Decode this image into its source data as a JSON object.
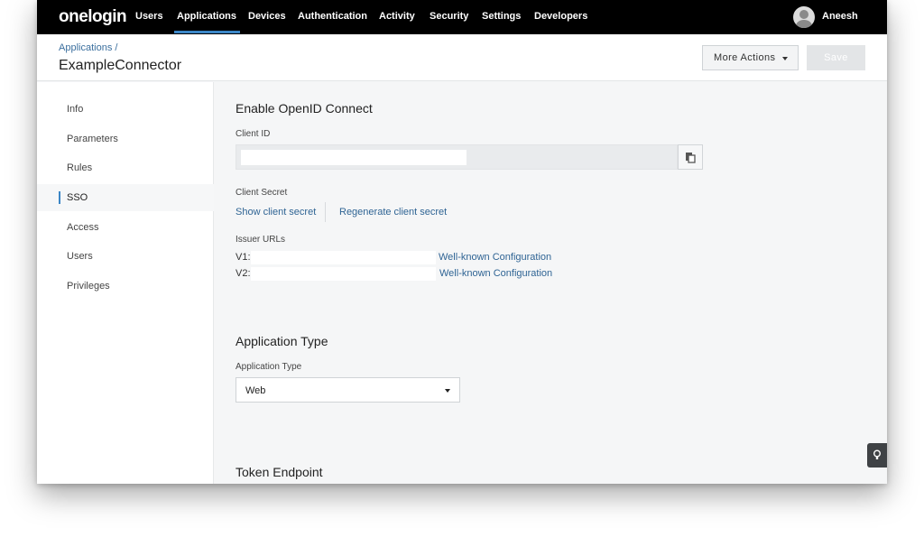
{
  "nav": {
    "logo": "onelogin",
    "items": [
      "Users",
      "Applications",
      "Devices",
      "Authentication",
      "Activity",
      "Security",
      "Settings",
      "Developers"
    ],
    "user": "Aneesh"
  },
  "header": {
    "breadcrumb": "Applications /",
    "title": "ExampleConnector",
    "more_actions": "More Actions",
    "save": "Save"
  },
  "sidebar": {
    "items": [
      {
        "label": "Info"
      },
      {
        "label": "Parameters"
      },
      {
        "label": "Rules"
      },
      {
        "label": "SSO"
      },
      {
        "label": "Access"
      },
      {
        "label": "Users"
      },
      {
        "label": "Privileges"
      }
    ],
    "active": "SSO"
  },
  "main": {
    "oidc_title": "Enable OpenID Connect",
    "client_id_label": "Client ID",
    "client_secret_label": "Client Secret",
    "show_secret": "Show client secret",
    "regenerate_secret": "Regenerate client secret",
    "issuer_urls_label": "Issuer URLs",
    "issuers": [
      {
        "version": "V1:",
        "link": "Well-known Configuration"
      },
      {
        "version": "V2:",
        "link": "Well-known Configuration"
      }
    ],
    "app_type_title": "Application Type",
    "app_type_label": "Application Type",
    "app_type_value": "Web",
    "token_endpoint_title": "Token Endpoint"
  },
  "icons": {
    "copy": "copy-icon",
    "help": "lightbulb-icon",
    "dropdown": "chevron-down-icon"
  },
  "colors": {
    "accent": "#3b86c6",
    "link": "#2f6494",
    "nav_bg": "#000000"
  }
}
